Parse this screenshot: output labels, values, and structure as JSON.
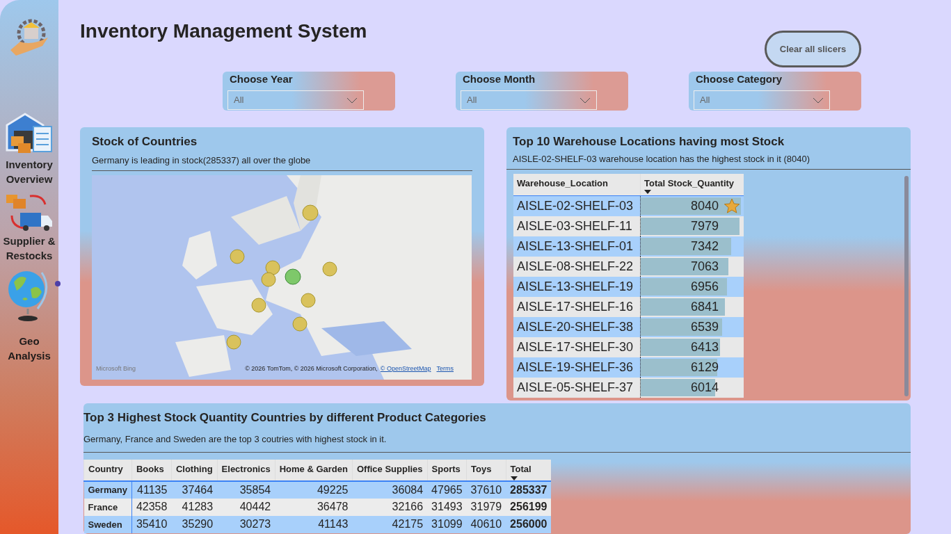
{
  "sidebar": {
    "items": [
      {
        "label": "Inventory Overview",
        "kind": "warehouse",
        "selected": false
      },
      {
        "label": "Supplier & Restocks",
        "kind": "truck",
        "selected": false
      },
      {
        "label": "Geo Analysis",
        "kind": "globe",
        "selected": true
      }
    ]
  },
  "title": "Inventory Management System",
  "clear_button": "Clear all slicers",
  "slicers": [
    {
      "label": "Choose Year",
      "value": "All"
    },
    {
      "label": "Choose Month",
      "value": "All"
    },
    {
      "label": "Choose Category",
      "value": "All"
    }
  ],
  "map_card": {
    "title": "Stock of Countries",
    "subtitle": "Germany is leading in stock(285337) all over the globe",
    "attribution": {
      "brand": "Microsoft Bing",
      "copyright": "© 2026 TomTom, © 2026 Microsoft Corporation,",
      "osm_link": "© OpenStreetMap",
      "terms_link": "Terms"
    }
  },
  "warehouse_card": {
    "title": "Top 10 Warehouse Locations having most Stock",
    "subtitle": "AISLE-02-SHELF-03 warehouse location has the highest stock in it (8040)",
    "columns": [
      {
        "label": "Warehouse_Location",
        "sorted": false
      },
      {
        "label": "Total Stock_Quantity",
        "sorted": true
      }
    ],
    "rows": [
      {
        "location": "AISLE-02-SHELF-03",
        "quantity": "8040",
        "level": 0.97,
        "starred": true
      },
      {
        "location": "AISLE-03-SHELF-11",
        "quantity": "7979",
        "level": 0.96,
        "starred": false
      },
      {
        "location": "AISLE-13-SHELF-01",
        "quantity": "7342",
        "level": 0.88,
        "starred": false
      },
      {
        "location": "AISLE-08-SHELF-22",
        "quantity": "7063",
        "level": 0.85,
        "starred": false
      },
      {
        "location": "AISLE-13-SHELF-19",
        "quantity": "6956",
        "level": 0.84,
        "starred": false
      },
      {
        "location": "AISLE-17-SHELF-16",
        "quantity": "6841",
        "level": 0.82,
        "starred": false
      },
      {
        "location": "AISLE-20-SHELF-38",
        "quantity": "6539",
        "level": 0.79,
        "starred": false
      },
      {
        "location": "AISLE-17-SHELF-30",
        "quantity": "6413",
        "level": 0.77,
        "starred": false
      },
      {
        "location": "AISLE-19-SHELF-36",
        "quantity": "6129",
        "level": 0.74,
        "starred": false
      },
      {
        "location": "AISLE-05-SHELF-37",
        "quantity": "6014",
        "level": 0.72,
        "starred": false
      }
    ]
  },
  "category_card": {
    "title": "Top 3 Highest Stock Quantity Countries by different Product Categories",
    "subtitle": "Germany, France and Sweden are the top 3 coutries with highest stock in it.",
    "columns": [
      {
        "label": "Country",
        "sorted": false
      },
      {
        "label": "Books",
        "sorted": false
      },
      {
        "label": "Clothing",
        "sorted": false
      },
      {
        "label": "Electronics",
        "sorted": false
      },
      {
        "label": "Home & Garden",
        "sorted": false
      },
      {
        "label": "Office Supplies",
        "sorted": false
      },
      {
        "label": "Sports",
        "sorted": false
      },
      {
        "label": "Toys",
        "sorted": false
      },
      {
        "label": "Total",
        "sorted": true
      }
    ],
    "rows": [
      [
        "Germany",
        "41135",
        "37464",
        "35854",
        "49225",
        "36084",
        "47965",
        "37610",
        "285337"
      ],
      [
        "France",
        "42358",
        "41283",
        "40442",
        "36478",
        "32166",
        "31493",
        "31979",
        "256199"
      ],
      [
        "Sweden",
        "35410",
        "35290",
        "30273",
        "41143",
        "42175",
        "31099",
        "40610",
        "256000"
      ]
    ]
  }
}
